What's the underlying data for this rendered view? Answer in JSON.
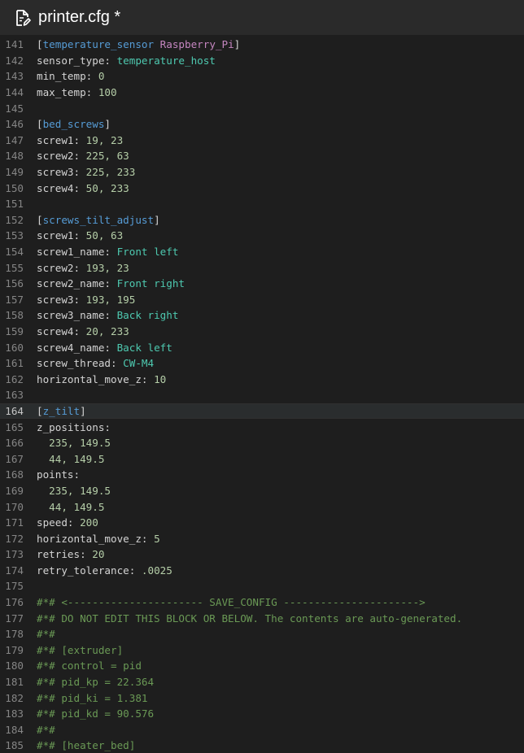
{
  "title": "printer.cfg *",
  "icon": "file-edit-icon",
  "colors": {
    "background": "#1e1e1e",
    "titlebar": "#2a2a2a",
    "line_number": "#858585",
    "section": "#569cd6",
    "string": "#4ec9b0",
    "number": "#b5cea8",
    "comment": "#6a9955",
    "subname": "#c586c0"
  },
  "active_line": "164",
  "lines": [
    {
      "n": "141",
      "parts": [
        [
          "br",
          "["
        ],
        [
          "sec",
          "temperature_sensor"
        ],
        [
          "br",
          " "
        ],
        [
          "sub",
          "Raspberry_Pi"
        ],
        [
          "br",
          "]"
        ]
      ]
    },
    {
      "n": "142",
      "parts": [
        [
          "key",
          "sensor_type: "
        ],
        [
          "str",
          "temperature_host"
        ]
      ]
    },
    {
      "n": "143",
      "parts": [
        [
          "key",
          "min_temp: "
        ],
        [
          "num",
          "0"
        ]
      ]
    },
    {
      "n": "144",
      "parts": [
        [
          "key",
          "max_temp: "
        ],
        [
          "num",
          "100"
        ]
      ]
    },
    {
      "n": "145",
      "parts": []
    },
    {
      "n": "146",
      "parts": [
        [
          "br",
          "["
        ],
        [
          "sec",
          "bed_screws"
        ],
        [
          "br",
          "]"
        ]
      ]
    },
    {
      "n": "147",
      "parts": [
        [
          "key",
          "screw1: "
        ],
        [
          "num",
          "19, 23"
        ]
      ]
    },
    {
      "n": "148",
      "parts": [
        [
          "key",
          "screw2: "
        ],
        [
          "num",
          "225, 63"
        ]
      ]
    },
    {
      "n": "149",
      "parts": [
        [
          "key",
          "screw3: "
        ],
        [
          "num",
          "225, 233"
        ]
      ]
    },
    {
      "n": "150",
      "parts": [
        [
          "key",
          "screw4: "
        ],
        [
          "num",
          "50, 233"
        ]
      ]
    },
    {
      "n": "151",
      "parts": []
    },
    {
      "n": "152",
      "parts": [
        [
          "br",
          "["
        ],
        [
          "sec",
          "screws_tilt_adjust"
        ],
        [
          "br",
          "]"
        ]
      ]
    },
    {
      "n": "153",
      "parts": [
        [
          "key",
          "screw1: "
        ],
        [
          "num",
          "50, 63"
        ]
      ]
    },
    {
      "n": "154",
      "parts": [
        [
          "key",
          "screw1_name: "
        ],
        [
          "str",
          "Front left"
        ]
      ]
    },
    {
      "n": "155",
      "parts": [
        [
          "key",
          "screw2: "
        ],
        [
          "num",
          "193, 23"
        ]
      ]
    },
    {
      "n": "156",
      "parts": [
        [
          "key",
          "screw2_name: "
        ],
        [
          "str",
          "Front right"
        ]
      ]
    },
    {
      "n": "157",
      "parts": [
        [
          "key",
          "screw3: "
        ],
        [
          "num",
          "193, 195"
        ]
      ]
    },
    {
      "n": "158",
      "parts": [
        [
          "key",
          "screw3_name: "
        ],
        [
          "str",
          "Back right"
        ]
      ]
    },
    {
      "n": "159",
      "parts": [
        [
          "key",
          "screw4: "
        ],
        [
          "num",
          "20, 233"
        ]
      ]
    },
    {
      "n": "160",
      "parts": [
        [
          "key",
          "screw4_name: "
        ],
        [
          "str",
          "Back left"
        ]
      ]
    },
    {
      "n": "161",
      "parts": [
        [
          "key",
          "screw_thread: "
        ],
        [
          "str",
          "CW-M4"
        ]
      ]
    },
    {
      "n": "162",
      "parts": [
        [
          "key",
          "horizontal_move_z: "
        ],
        [
          "num",
          "10"
        ]
      ]
    },
    {
      "n": "163",
      "parts": []
    },
    {
      "n": "164",
      "parts": [
        [
          "br",
          "["
        ],
        [
          "sec",
          "z_tilt"
        ],
        [
          "br",
          "]"
        ]
      ]
    },
    {
      "n": "165",
      "parts": [
        [
          "key",
          "z_positions:"
        ]
      ]
    },
    {
      "n": "166",
      "parts": [
        [
          "key",
          "  "
        ],
        [
          "num",
          "235, 149.5"
        ]
      ]
    },
    {
      "n": "167",
      "parts": [
        [
          "key",
          "  "
        ],
        [
          "num",
          "44, 149.5"
        ]
      ]
    },
    {
      "n": "168",
      "parts": [
        [
          "key",
          "points:"
        ]
      ]
    },
    {
      "n": "169",
      "parts": [
        [
          "key",
          "  "
        ],
        [
          "num",
          "235, 149.5"
        ]
      ]
    },
    {
      "n": "170",
      "parts": [
        [
          "key",
          "  "
        ],
        [
          "num",
          "44, 149.5"
        ]
      ]
    },
    {
      "n": "171",
      "parts": [
        [
          "key",
          "speed: "
        ],
        [
          "num",
          "200"
        ]
      ]
    },
    {
      "n": "172",
      "parts": [
        [
          "key",
          "horizontal_move_z: "
        ],
        [
          "num",
          "5"
        ]
      ]
    },
    {
      "n": "173",
      "parts": [
        [
          "key",
          "retries: "
        ],
        [
          "num",
          "20"
        ]
      ]
    },
    {
      "n": "174",
      "parts": [
        [
          "key",
          "retry_tolerance: "
        ],
        [
          "num",
          ".0025"
        ]
      ]
    },
    {
      "n": "175",
      "parts": []
    },
    {
      "n": "176",
      "parts": [
        [
          "cm",
          "#*# <---------------------- SAVE_CONFIG ---------------------->"
        ]
      ]
    },
    {
      "n": "177",
      "parts": [
        [
          "cm",
          "#*# DO NOT EDIT THIS BLOCK OR BELOW. The contents are auto-generated."
        ]
      ]
    },
    {
      "n": "178",
      "parts": [
        [
          "cm",
          "#*#"
        ]
      ]
    },
    {
      "n": "179",
      "parts": [
        [
          "cm",
          "#*# [extruder]"
        ]
      ]
    },
    {
      "n": "180",
      "parts": [
        [
          "cm",
          "#*# control = pid"
        ]
      ]
    },
    {
      "n": "181",
      "parts": [
        [
          "cm",
          "#*# pid_kp = 22.364"
        ]
      ]
    },
    {
      "n": "182",
      "parts": [
        [
          "cm",
          "#*# pid_ki = 1.381"
        ]
      ]
    },
    {
      "n": "183",
      "parts": [
        [
          "cm",
          "#*# pid_kd = 90.576"
        ]
      ]
    },
    {
      "n": "184",
      "parts": [
        [
          "cm",
          "#*#"
        ]
      ]
    },
    {
      "n": "185",
      "parts": [
        [
          "cm",
          "#*# [heater_bed]"
        ]
      ]
    }
  ]
}
